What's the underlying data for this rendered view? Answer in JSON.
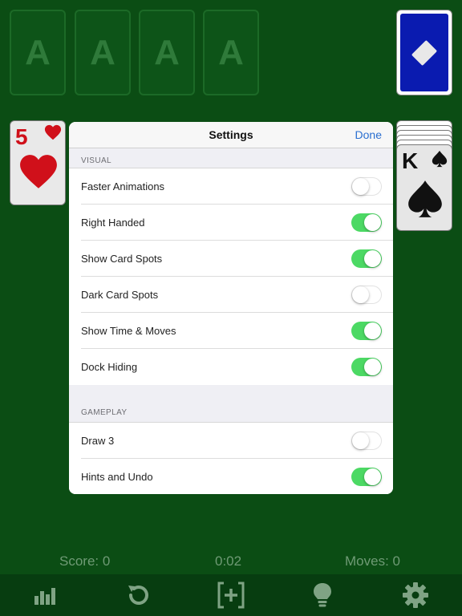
{
  "foundations": [
    {
      "label": "A"
    },
    {
      "label": "A"
    },
    {
      "label": "A"
    },
    {
      "label": "A"
    }
  ],
  "left_card": {
    "rank": "5",
    "suit": "heart-icon"
  },
  "right_card": {
    "rank": "K",
    "suit": "spade-icon"
  },
  "settings": {
    "title": "Settings",
    "done_label": "Done",
    "visual_header": "VISUAL",
    "visual_items": [
      {
        "label": "Faster Animations",
        "enabled": false
      },
      {
        "label": "Right Handed",
        "enabled": true
      },
      {
        "label": "Show Card Spots",
        "enabled": true
      },
      {
        "label": "Dark Card Spots",
        "enabled": false
      },
      {
        "label": "Show Time & Moves",
        "enabled": true
      },
      {
        "label": "Dock Hiding",
        "enabled": true
      }
    ],
    "gameplay_header": "GAMEPLAY",
    "gameplay_items": [
      {
        "label": "Draw 3",
        "enabled": false
      },
      {
        "label": "Hints and Undo",
        "enabled": true
      }
    ]
  },
  "status": {
    "score": "Score: 0",
    "time": "0:02",
    "moves": "Moves: 0"
  },
  "toolbar": {
    "icons": [
      "bar-chart-icon",
      "undo-icon",
      "new-game-icon",
      "lightbulb-icon",
      "gear-icon"
    ]
  },
  "colors": {
    "table_green": "#0b4d14",
    "toggle_on": "#4cd964",
    "link_blue": "#2a6fd0",
    "card_back_blue": "#0a1bb0"
  }
}
